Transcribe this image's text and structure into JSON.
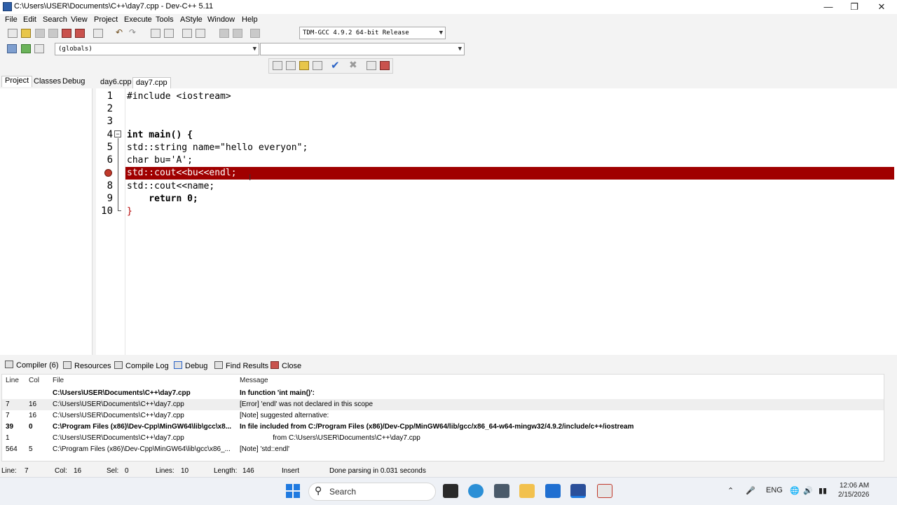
{
  "window": {
    "title": "C:\\Users\\USER\\Documents\\C++\\day7.cpp - Dev-C++ 5.11"
  },
  "menu": [
    "File",
    "Edit",
    "Search",
    "View",
    "Project",
    "Execute",
    "Tools",
    "AStyle",
    "Window",
    "Help"
  ],
  "toolbar": {
    "compiler_select": "TDM-GCC 4.9.2 64-bit Release",
    "scope_select": "(globals)",
    "symbol_select": ""
  },
  "left_tabs": [
    "Project",
    "Classes",
    "Debug"
  ],
  "editor_tabs": [
    "day6.cpp",
    "day7.cpp"
  ],
  "code": [
    {
      "n": "1",
      "text": "#include <iostream>"
    },
    {
      "n": "2",
      "text": ""
    },
    {
      "n": "3",
      "text": ""
    },
    {
      "n": "4",
      "text": "int main() {"
    },
    {
      "n": "5",
      "text": "std::string name=\"hello everyon\";"
    },
    {
      "n": "6",
      "text": "char bu='A';"
    },
    {
      "n": "7",
      "text": "std::cout<<bu<<endl;"
    },
    {
      "n": "8",
      "text": "std::cout<<name;"
    },
    {
      "n": "9",
      "text": "    return 0;"
    },
    {
      "n": "10",
      "text": "}"
    }
  ],
  "bottom_tabs": [
    "Compiler (6)",
    "Resources",
    "Compile Log",
    "Debug",
    "Find Results",
    "Close"
  ],
  "messages": {
    "headers": [
      "Line",
      "Col",
      "File",
      "Message"
    ],
    "rows": [
      {
        "line": "",
        "col": "",
        "file": "C:\\Users\\USER\\Documents\\C++\\day7.cpp",
        "message": "In function 'int main()':",
        "bold": true
      },
      {
        "line": "7",
        "col": "16",
        "file": "C:\\Users\\USER\\Documents\\C++\\day7.cpp",
        "message": "[Error] 'endl' was not declared in this scope",
        "bold": false
      },
      {
        "line": "7",
        "col": "16",
        "file": "C:\\Users\\USER\\Documents\\C++\\day7.cpp",
        "message": "[Note] suggested alternative:",
        "bold": false
      },
      {
        "line": "39",
        "col": "0",
        "file": "C:\\Program Files (x86)\\Dev-Cpp\\MinGW64\\lib\\gcc\\x8...",
        "message": "In file included from C:/Program Files (x86)/Dev-Cpp/MinGW64/lib/gcc/x86_64-w64-mingw32/4.9.2/include/c++/iostream",
        "bold": true
      },
      {
        "line": "1",
        "col": "",
        "file": "C:\\Users\\USER\\Documents\\C++\\day7.cpp",
        "message": "                 from C:\\Users\\USER\\Documents\\C++\\day7.cpp",
        "bold": false
      },
      {
        "line": "564",
        "col": "5",
        "file": "C:\\Program Files (x86)\\Dev-Cpp\\MinGW64\\lib\\gcc\\x86_...",
        "message": "[Note] 'std::endl'",
        "bold": false
      }
    ]
  },
  "status": {
    "line_label": "Line:",
    "line": "7",
    "col_label": "Col:",
    "col": "16",
    "sel_label": "Sel:",
    "sel": "0",
    "lines_label": "Lines:",
    "lines": "10",
    "length_label": "Length:",
    "length": "146",
    "mode": "Insert",
    "message": "Done parsing in 0.031 seconds"
  },
  "taskbar": {
    "search_placeholder": "Search",
    "lang": "ENG",
    "time": "12:06 AM",
    "date": "2/15/2026"
  },
  "colors": {
    "error_line": "#a00000",
    "string": "#1a1aa6",
    "symbol": "#b50000"
  }
}
